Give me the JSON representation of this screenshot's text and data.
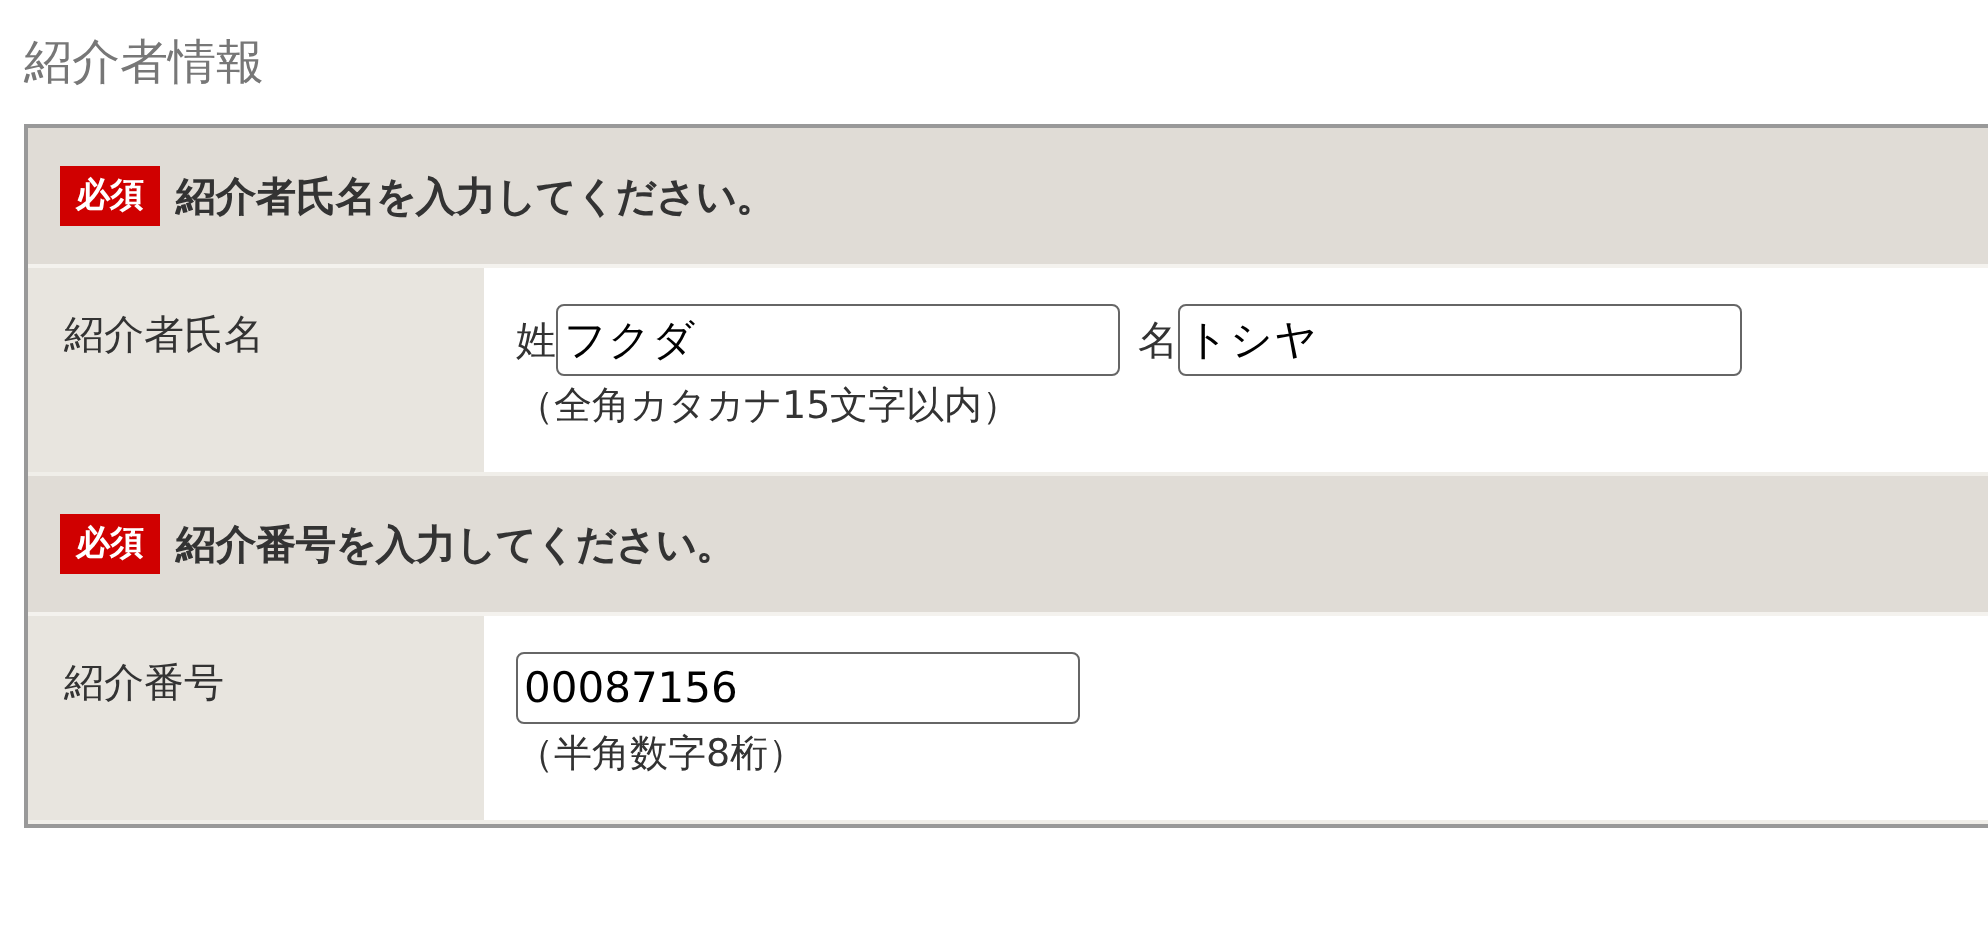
{
  "heading": "紹介者情報",
  "sections": [
    {
      "badge": "必須",
      "prompt": "紹介者氏名を入力してください。",
      "label": "紹介者氏名",
      "fields": [
        {
          "prefix": "姓",
          "value": "フクダ"
        },
        {
          "prefix": "名",
          "value": "トシヤ"
        }
      ],
      "hint": "（全角カタカナ15文字以内）"
    },
    {
      "badge": "必須",
      "prompt": "紹介番号を入力してください。",
      "label": "紹介番号",
      "fields": [
        {
          "value": "00087156"
        }
      ],
      "hint": "（半角数字8桁）"
    }
  ]
}
